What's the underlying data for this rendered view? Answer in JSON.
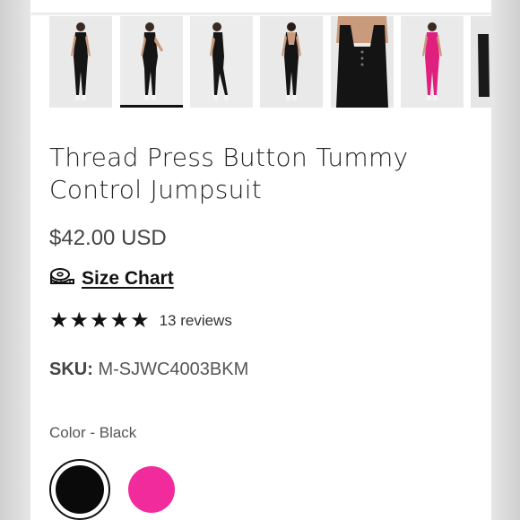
{
  "product": {
    "title": "Thread Press Button Tummy Control Jumpsuit",
    "price": "$42.00 USD",
    "size_chart_label": "Size Chart",
    "rating_stars": "★★★★★",
    "rating_value": 5,
    "reviews_label": "13 reviews",
    "sku_label": "SKU:",
    "sku_value": "M-SJWC4003BKM",
    "color_label": "Color - Black",
    "colors": [
      {
        "name": "Black",
        "hex": "#0a0a0a",
        "selected": true
      },
      {
        "name": "Pink",
        "hex": "#f22b9c",
        "selected": false
      }
    ]
  },
  "gallery": {
    "thumbnails": [
      {
        "view": "front",
        "color": "black",
        "selected": false
      },
      {
        "view": "three-quarter",
        "color": "black",
        "selected": true
      },
      {
        "view": "side",
        "color": "black",
        "selected": false
      },
      {
        "view": "back",
        "color": "black",
        "selected": false
      },
      {
        "view": "close-up",
        "color": "black",
        "selected": false
      },
      {
        "view": "front",
        "color": "pink",
        "selected": false
      },
      {
        "view": "partial",
        "color": "black",
        "selected": false
      }
    ]
  },
  "icons": {
    "size_chart": "measuring-tape-icon",
    "rating": "star-icon"
  }
}
